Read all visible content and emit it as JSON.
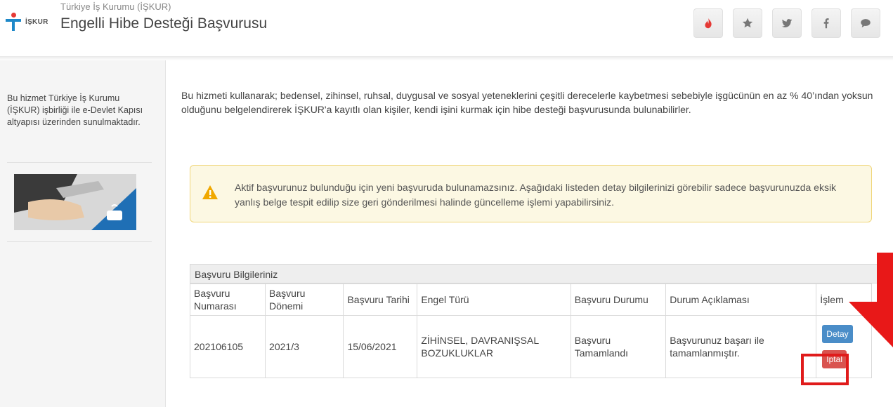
{
  "header": {
    "logo_text": "İŞKUR",
    "org_name": "Türkiye İş Kurumu (İŞKUR)",
    "service_title": "Engelli Hibe Desteği Başvurusu",
    "icons": [
      "fire-icon",
      "star-icon",
      "twitter-icon",
      "facebook-icon",
      "chat-icon"
    ],
    "fire_color": "#e53935"
  },
  "sidebar": {
    "description": "Bu hizmet Türkiye İş Kurumu (İŞKUR) işbirliği ile e-Devlet Kapısı altyapısı üzerinden sunulmaktadır."
  },
  "main": {
    "intro": "Bu hizmeti kullanarak; bedensel, zihinsel, ruhsal, duygusal ve sosyal yeteneklerini çeşitli derecelerle kaybetmesi sebebiyle işgücünün en az % 40’ından yoksun olduğunu belgelendirerek İŞKUR'a kayıtlı olan kişiler, kendi işini kurmak için hibe desteği başvurusunda bulunabilirler.",
    "warning": "Aktif başvurunuz bulunduğu için yeni başvuruda bulunamazsınız. Aşağıdaki listeden detay bilgilerinizi görebilir sadece başvurunuzda eksik yanlış belge tespit edilip size geri gönderilmesi halinde güncelleme işlemi yapabilirsiniz."
  },
  "table": {
    "panel_title": "Başvuru Bilgileriniz",
    "headers": [
      "Başvuru Numarası",
      "Başvuru Dönemi",
      "Başvuru Tarihi",
      "Engel Türü",
      "Başvuru Durumu",
      "Durum Açıklaması",
      "İşlem"
    ],
    "row": {
      "number": "202106105",
      "period": "2021/3",
      "date": "15/06/2021",
      "disability": "ZİHİNSEL, DAVRANIŞSAL BOZUKLUKLAR",
      "status": "Başvuru Tamamlandı",
      "status_desc": "Başvurunuz başarı ile tamamlanmıştır.",
      "detail_label": "Detay",
      "cancel_label": "İptal"
    }
  },
  "colors": {
    "detail_button": "#4a8dc8",
    "cancel_button": "#d9534f",
    "annotation": "#e01b1b",
    "warning_bg": "#fcf8e3"
  }
}
